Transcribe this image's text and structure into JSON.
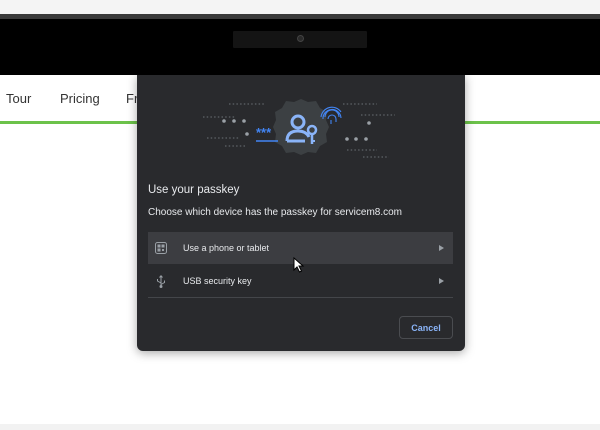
{
  "site": {
    "nav": [
      "Tour",
      "Pricing",
      "Fr"
    ],
    "accent": "#6cc24a"
  },
  "dialog": {
    "title": "Use your passkey",
    "subtitle": "Choose which device has the passkey for servicem8.com",
    "illustration_text": "***",
    "options": [
      {
        "label": "Use a phone or tablet",
        "icon": "qr-code-icon",
        "hovered": true
      },
      {
        "label": "USB security key",
        "icon": "usb-icon",
        "hovered": false
      }
    ],
    "cancel_label": "Cancel",
    "accent": "#8ab4f8",
    "background": "#292a2d"
  }
}
